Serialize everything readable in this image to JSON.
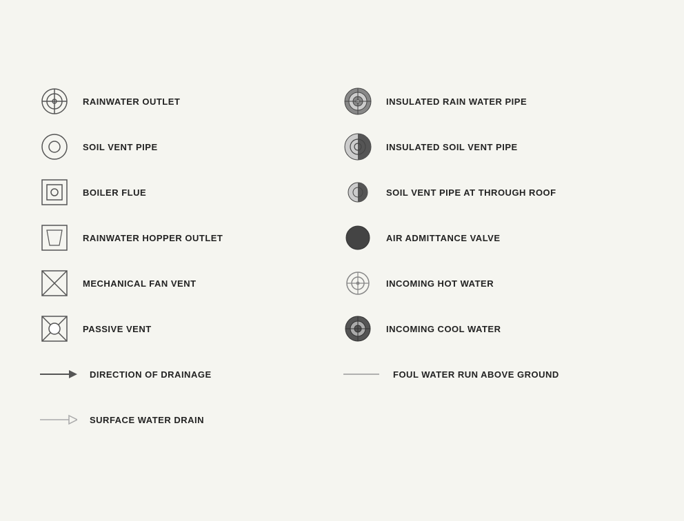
{
  "items_left": [
    {
      "id": "rainwater-outlet",
      "label": "RAINWATER OUTLET",
      "icon": "rainwater-outlet"
    },
    {
      "id": "soil-vent-pipe",
      "label": "SOIL VENT PIPE",
      "icon": "soil-vent-pipe"
    },
    {
      "id": "boiler-flue",
      "label": "BOILER FLUE",
      "icon": "boiler-flue"
    },
    {
      "id": "rainwater-hopper-outlet",
      "label": "RAINWATER HOPPER OUTLET",
      "icon": "rainwater-hopper-outlet"
    },
    {
      "id": "mechanical-fan-vent",
      "label": "MECHANICAL FAN VENT",
      "icon": "mechanical-fan-vent"
    },
    {
      "id": "passive-vent",
      "label": "PASSIVE VENT",
      "icon": "passive-vent"
    },
    {
      "id": "direction-of-drainage",
      "label": "DIRECTION OF DRAINAGE",
      "icon": "direction-of-drainage"
    },
    {
      "id": "surface-water-drain",
      "label": "SURFACE WATER DRAIN",
      "icon": "surface-water-drain"
    }
  ],
  "items_right": [
    {
      "id": "insulated-rain-water-pipe",
      "label": "INSULATED RAIN WATER PIPE",
      "icon": "insulated-rain-water-pipe"
    },
    {
      "id": "insulated-soil-vent-pipe",
      "label": "INSULATED SOIL VENT PIPE",
      "icon": "insulated-soil-vent-pipe"
    },
    {
      "id": "soil-vent-pipe-through-roof",
      "label": "SOIL VENT PIPE AT THROUGH ROOF",
      "icon": "soil-vent-pipe-through-roof"
    },
    {
      "id": "air-admittance-valve",
      "label": "AIR ADMITTANCE VALVE",
      "icon": "air-admittance-valve"
    },
    {
      "id": "incoming-hot-water",
      "label": "INCOMING HOT WATER",
      "icon": "incoming-hot-water"
    },
    {
      "id": "incoming-cool-water",
      "label": "INCOMING COOL WATER",
      "icon": "incoming-cool-water"
    },
    {
      "id": "foul-water-run-above-ground",
      "label": "FOUL WATER RUN ABOVE GROUND",
      "icon": "foul-water-run-above-ground"
    },
    {
      "id": "empty",
      "label": "",
      "icon": "none"
    }
  ]
}
